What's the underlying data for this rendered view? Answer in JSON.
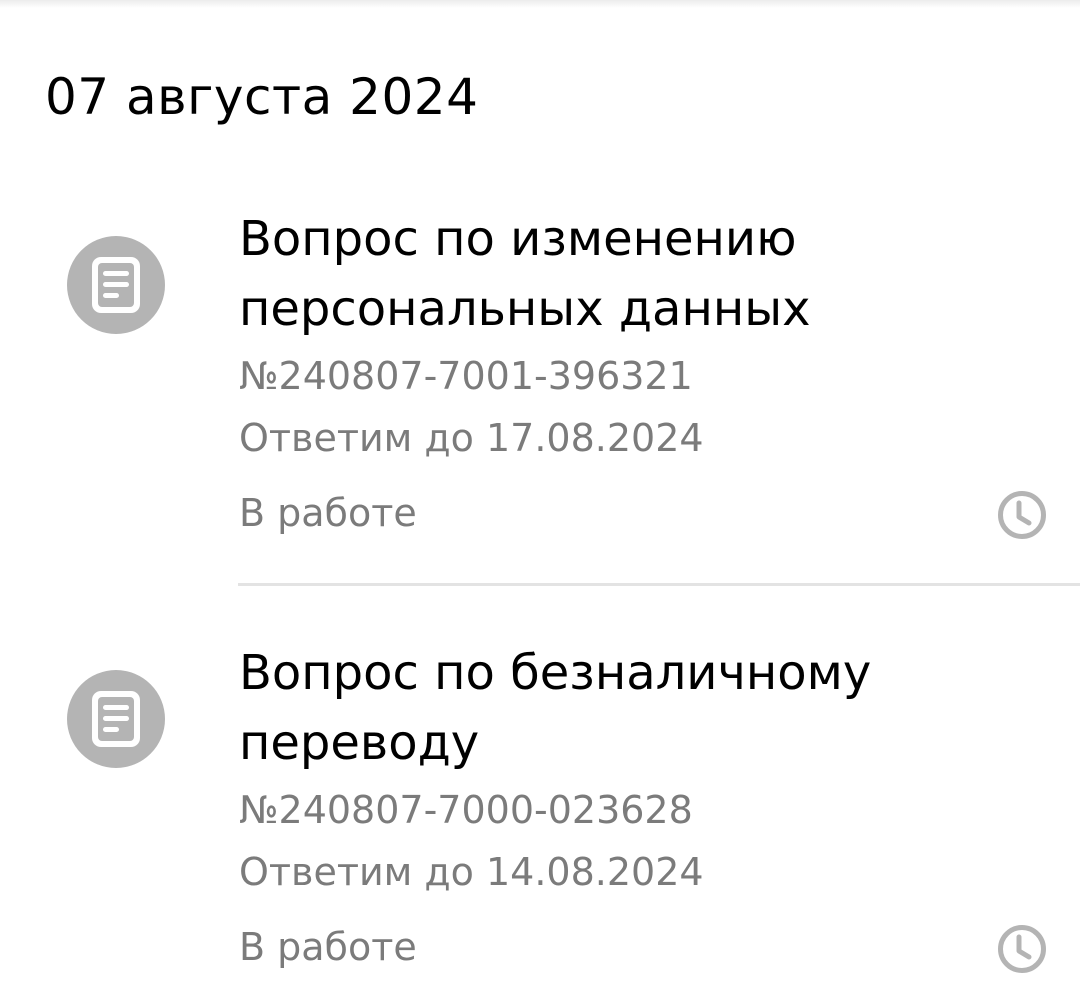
{
  "date_header": "07 августа 2024",
  "tickets": [
    {
      "title": "Вопрос по изменению персональных данных",
      "number": "№240807-7001-396321",
      "deadline": "Ответим до 17.08.2024",
      "status": "В работе",
      "icon": "document-icon",
      "status_icon": "clock-icon"
    },
    {
      "title": "Вопрос по безналичному переводу",
      "number": "№240807-7000-023628",
      "deadline": "Ответим до 14.08.2024",
      "status": "В работе",
      "icon": "document-icon",
      "status_icon": "clock-icon"
    }
  ],
  "colors": {
    "icon_circle": "#b4b4b4",
    "secondary_text": "#7b7b7b",
    "divider": "#e3e3e3"
  }
}
